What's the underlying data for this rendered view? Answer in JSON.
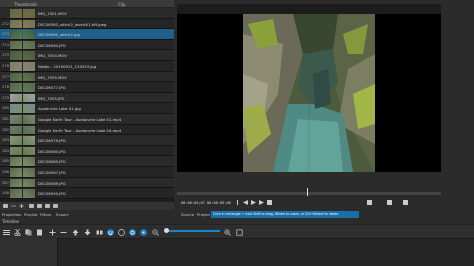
{
  "playlist": {
    "headers": {
      "thumbnails": "Thumbnails",
      "clip": "Clip"
    },
    "rows": [
      {
        "num": "",
        "name": "IMG_7501.MOV",
        "colors": [
          "#5e6b47",
          "#7a6a44"
        ]
      },
      {
        "num": "272",
        "name": "DSC06563_stitch2_levels01.tiff.jpeg",
        "colors": [
          "#6d7352",
          "#8a7e5c"
        ]
      },
      {
        "num": "273",
        "name": "DSC06560_stitch2.jpg",
        "colors": [
          "#3f5a3a",
          "#5a7a5a"
        ],
        "selected": true
      },
      {
        "num": "274",
        "name": "DSC06564.JPG",
        "colors": [
          "#566a4a",
          "#6f7f61"
        ]
      },
      {
        "num": "275",
        "name": "IMG_7504.MOV",
        "colors": [
          "#4a5a3f",
          "#5e6b49"
        ]
      },
      {
        "num": "276",
        "name": "Waldo - 20190911_134533.jpg",
        "colors": [
          "#7a8066",
          "#8b8574"
        ]
      },
      {
        "num": "277",
        "name": "IMG_7505.MOV",
        "colors": [
          "#48603f",
          "#6a7755"
        ]
      },
      {
        "num": "278",
        "name": "DSC06577.JPG",
        "colors": [
          "#52684a",
          "#687a5b"
        ]
      },
      {
        "num": "279",
        "name": "IMG_7505.JPG",
        "colors": [
          "#a0a6a9",
          "#7f8e6a"
        ]
      },
      {
        "num": "280",
        "name": "Avalanche Lake 01.jpg",
        "colors": [
          "#6f8a9b",
          "#809164"
        ]
      },
      {
        "num": "281",
        "name": "Google Earth Tour - Avalanche Lake 01.mp4",
        "colors": [
          "#7b8a74",
          "#5b6e4f"
        ]
      },
      {
        "num": "282",
        "name": "Google Earth Tour - Avalanche Lake 04.mp4",
        "colors": [
          "#6d7d6a",
          "#5a6b50"
        ]
      },
      {
        "num": "283",
        "name": "DSC06579.JPG",
        "colors": [
          "#8a9678",
          "#6c7f5a"
        ]
      },
      {
        "num": "284",
        "name": "DSC06580.JPG",
        "colors": [
          "#7b8a6a",
          "#667a52"
        ]
      },
      {
        "num": "285",
        "name": "DSC06585.JPG",
        "colors": [
          "#5d6e4d",
          "#84906e"
        ]
      },
      {
        "num": "286",
        "name": "DSC06587.JPG",
        "colors": [
          "#5a6848",
          "#7e8a6a"
        ]
      },
      {
        "num": "287",
        "name": "DSC06589.JPG",
        "colors": [
          "#596a4a",
          "#7d8b6b"
        ]
      },
      {
        "num": "288",
        "name": "DSC06590.JPG",
        "colors": [
          "#536446",
          "#778767"
        ]
      }
    ]
  },
  "panel_tabs": [
    "Properties",
    "Playlist",
    "Filters",
    "Export"
  ],
  "viewer": {
    "timecode_current": "00:00:04;07",
    "timecode_total": "00:00:05;00",
    "tabs": [
      "Source",
      "Project"
    ],
    "tooltip": "Click in rectangle + hold Shift to drag, Wheel to zoom, or Ctrl+Wheel to rotate"
  },
  "timeline": {
    "label": "Timeline"
  },
  "colors": {
    "accent": "#1a84c6",
    "selected": "#1f5f8b"
  }
}
